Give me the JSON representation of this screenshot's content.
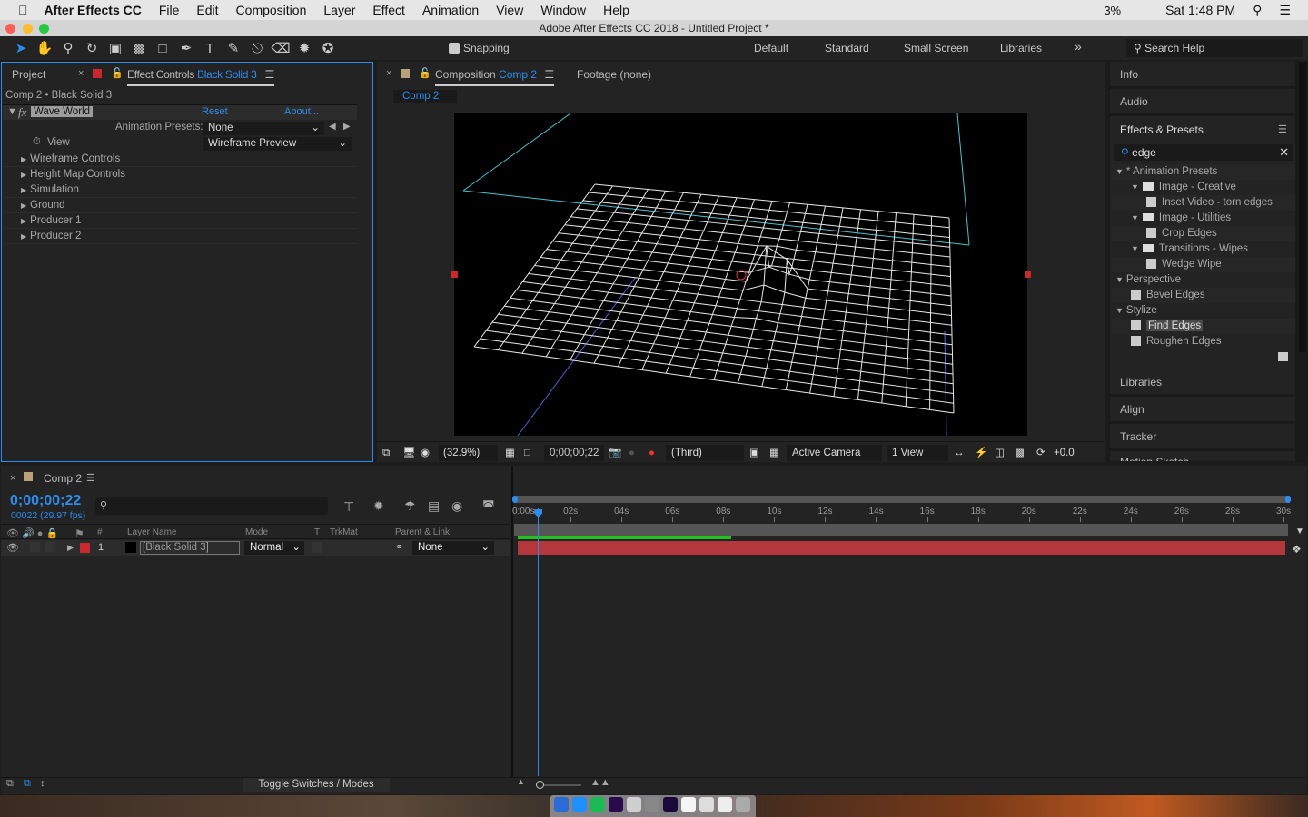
{
  "menubar": {
    "apple": "",
    "app": "After Effects CC",
    "items": [
      "File",
      "Edit",
      "Composition",
      "Layer",
      "Effect",
      "Animation",
      "View",
      "Window",
      "Help"
    ],
    "battery": "3%",
    "clock": "Sat 1:48 PM"
  },
  "window": {
    "title": "Adobe After Effects CC 2018 - Untitled Project *"
  },
  "toolbar": {
    "snapping": "Snapping",
    "workspaces": [
      "Default",
      "Standard",
      "Small Screen",
      "Libraries"
    ],
    "more": "»",
    "search_placeholder": "Search Help"
  },
  "effect_panel": {
    "tab_project": "Project",
    "tab_effect_prefix": "Effect Controls ",
    "tab_effect_layer": "Black Solid 3",
    "breadcrumb": "Comp 2 • Black Solid 3",
    "effect_name": "Wave World",
    "reset": "Reset",
    "about": "About...",
    "presets_label": "Animation Presets:",
    "presets_value": "None",
    "view_label": "View",
    "view_value": "Wireframe Preview",
    "groups": [
      "Wireframe Controls",
      "Height Map Controls",
      "Simulation",
      "Ground",
      "Producer 1",
      "Producer 2"
    ]
  },
  "comp_panel": {
    "tab_prefix": "Composition ",
    "tab_comp": "Comp 2",
    "footage_tab": "Footage (none)",
    "comp_chip": "Comp 2",
    "zoom": "(32.9%)",
    "timecode": "0;00;00;22",
    "resolution": "(Third)",
    "camera": "Active Camera",
    "views": "1 View",
    "exposure": "+0.0"
  },
  "right_panel": {
    "info": "Info",
    "audio": "Audio",
    "effects_presets": "Effects & Presets",
    "search_value": "edge",
    "tree": [
      {
        "level": 0,
        "type": "group",
        "label": "* Animation Presets"
      },
      {
        "level": 1,
        "type": "folder",
        "label": "Image - Creative"
      },
      {
        "level": 2,
        "type": "preset",
        "label": "Inset Video - torn edges"
      },
      {
        "level": 1,
        "type": "folder",
        "label": "Image - Utilities"
      },
      {
        "level": 2,
        "type": "preset",
        "label": "Crop Edges"
      },
      {
        "level": 1,
        "type": "folder",
        "label": "Transitions - Wipes"
      },
      {
        "level": 2,
        "type": "preset",
        "label": "Wedge Wipe"
      },
      {
        "level": 0,
        "type": "group",
        "label": "Perspective"
      },
      {
        "level": 1,
        "type": "preset",
        "label": "Bevel Edges"
      },
      {
        "level": 0,
        "type": "group",
        "label": "Stylize"
      },
      {
        "level": 1,
        "type": "preset",
        "label": "Find Edges",
        "selected": true
      },
      {
        "level": 1,
        "type": "preset",
        "label": "Roughen Edges"
      }
    ],
    "libraries": "Libraries",
    "align": "Align",
    "tracker": "Tracker",
    "motion_sketch": "Motion Sketch"
  },
  "timeline": {
    "tab": "Comp 2",
    "timecode": "0;00;00;22",
    "frames": "00022 (29.97 fps)",
    "columns": {
      "num": "#",
      "layer_name": "Layer Name",
      "mode": "Mode",
      "t": "T",
      "trkmat": "TrkMat",
      "parent": "Parent & Link"
    },
    "layers": [
      {
        "index": "1",
        "name": "[Black Solid 3]",
        "mode": "Normal",
        "parent": "None",
        "label_color": "#c8282e"
      }
    ],
    "ruler": [
      "0:00s",
      "02s",
      "04s",
      "06s",
      "08s",
      "10s",
      "12s",
      "14s",
      "16s",
      "18s",
      "20s",
      "22s",
      "24s",
      "26s",
      "28s",
      "30s"
    ],
    "toggle": "Toggle Switches / Modes",
    "current_time_fraction": 0.024,
    "work_area_rendered_fraction": 0.28
  },
  "colors": {
    "accent": "#2d8ceb",
    "layer_bar": "#b3373d",
    "render_bar": "#1fc21f"
  }
}
